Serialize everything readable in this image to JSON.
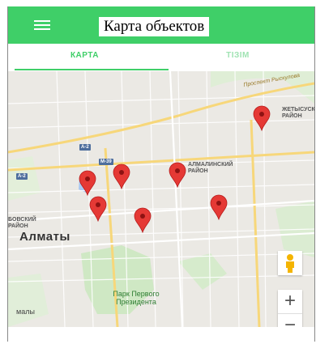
{
  "appbar": {
    "title": "Карта  объектов",
    "menu_icon": "hamburger-menu-icon",
    "color": "#3fcf68"
  },
  "tabs": [
    {
      "label": "КАРТА",
      "active": true
    },
    {
      "label": "TIЗIM",
      "active": false
    }
  ],
  "map": {
    "city_label": "Алматы",
    "district_labels": [
      {
        "text": "ЖЕТЫСУСКИЙ\nРАЙОН"
      },
      {
        "text": "АЛМАЛИНСКИЙ\nРАЙОН"
      },
      {
        "text": "БОВСКИЙ\nРАЙОН"
      }
    ],
    "street_label": "Проспект Рыскулова",
    "park_label": "Парк Первого\nПрезидента",
    "bottom_left_label": "малы",
    "road_badges": [
      "A-2",
      "M-39",
      "A-2"
    ],
    "marker_count": 7,
    "marker_color": "#e53935",
    "controls": {
      "street_view_icon": "pegman-icon",
      "zoom_in": "+",
      "zoom_out": "−"
    }
  }
}
